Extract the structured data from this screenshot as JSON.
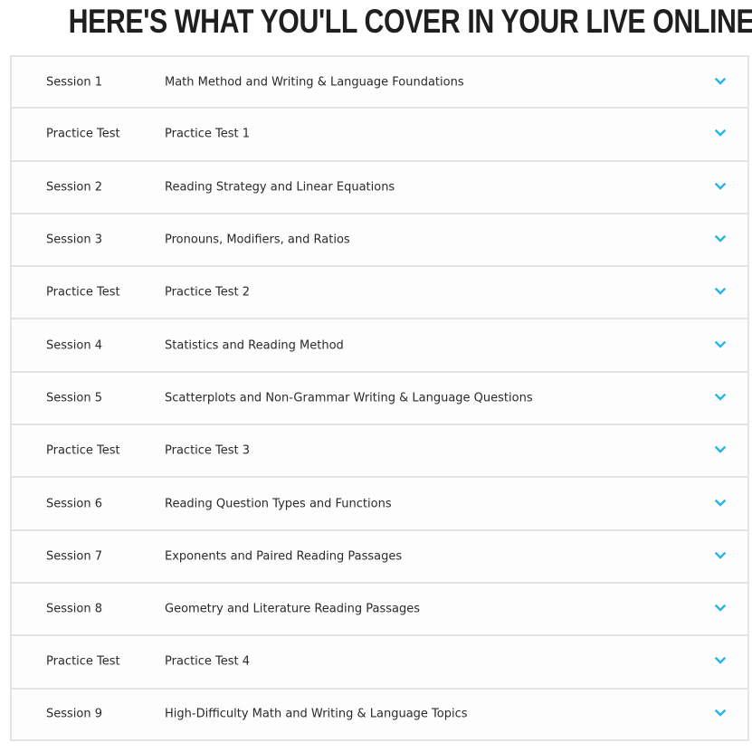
{
  "header": {
    "title": "HERE'S WHAT YOU'LL COVER IN YOUR LIVE ONLINE CLASS"
  },
  "accent_color": "#29b6e8",
  "sessions": [
    {
      "label": "Session 1",
      "topic": "Math Method and Writing & Language Foundations",
      "icon": "chevron-down-icon"
    },
    {
      "label": "Practice Test",
      "topic": "Practice Test 1",
      "icon": "chevron-down-icon"
    },
    {
      "label": "Session 2",
      "topic": "Reading Strategy and Linear Equations",
      "icon": "chevron-down-icon"
    },
    {
      "label": "Session 3",
      "topic": "Pronouns, Modifiers, and Ratios",
      "icon": "chevron-down-icon"
    },
    {
      "label": "Practice Test",
      "topic": "Practice Test 2",
      "icon": "chevron-down-icon"
    },
    {
      "label": "Session 4",
      "topic": "Statistics and Reading Method",
      "icon": "chevron-down-icon"
    },
    {
      "label": "Session 5",
      "topic": "Scatterplots and Non-Grammar Writing & Language Questions",
      "icon": "chevron-down-icon"
    },
    {
      "label": "Practice Test",
      "topic": "Practice Test 3",
      "icon": "chevron-down-icon"
    },
    {
      "label": "Session 6",
      "topic": "Reading Question Types and Functions",
      "icon": "chevron-down-icon"
    },
    {
      "label": "Session 7",
      "topic": "Exponents and Paired Reading Passages",
      "icon": "chevron-down-icon"
    },
    {
      "label": "Session 8",
      "topic": "Geometry and Literature Reading Passages",
      "icon": "chevron-down-icon"
    },
    {
      "label": "Practice Test",
      "topic": "Practice Test 4",
      "icon": "chevron-down-icon"
    },
    {
      "label": "Session 9",
      "topic": "High-Difficulty Math and Writing & Language Topics",
      "icon": "chevron-down-icon"
    }
  ]
}
